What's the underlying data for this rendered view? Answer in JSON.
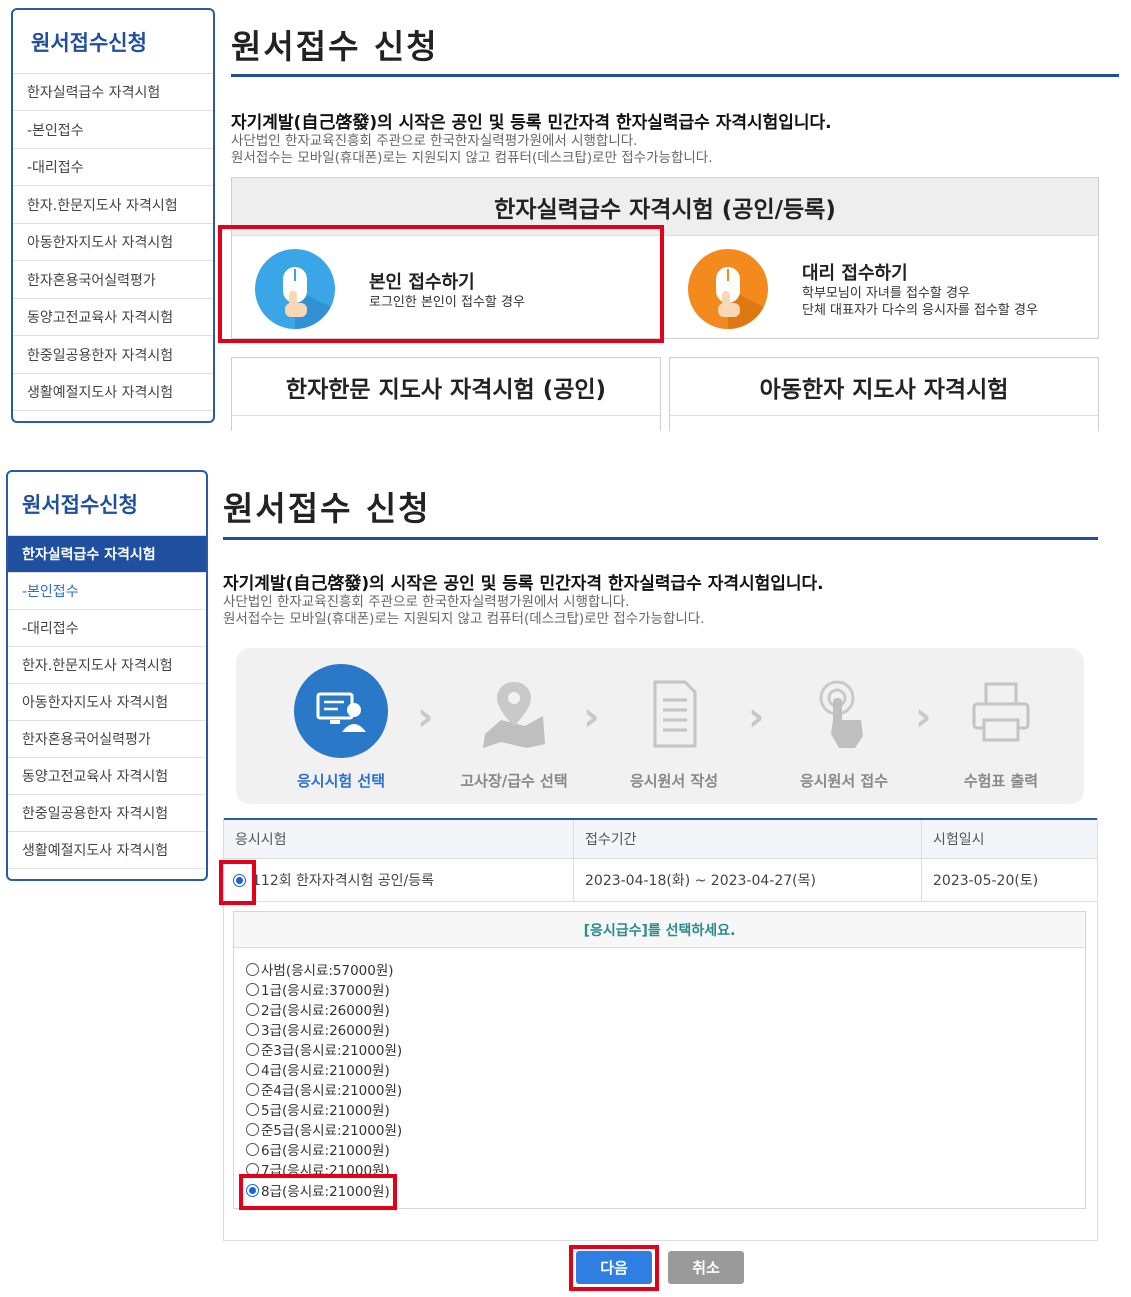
{
  "sidebar": {
    "title": "원서접수신청",
    "items": [
      "한자실력급수 자격시험",
      "-본인접수",
      "-대리접수",
      "한자.한문지도사 자격시험",
      "아동한자지도사 자격시험",
      "한자혼용국어실력평가",
      "동양고전교육사 자격시험",
      "한중일공용한자 자격시험",
      "생활예절지도사 자격시험"
    ]
  },
  "page": {
    "title": "원서접수 신청",
    "intro_prefix": "자기계발(",
    "intro_hanja": "自己啓發",
    "intro_suffix": ")의 시작은 공인 및 등록 민간자격 한자실력급수 자격시험입니다.",
    "intro_line2": "사단법인 한자교육진흥회 주관으로 한국한자실력평가원에서 시행합니다.",
    "intro_line3": "원서접수는 모바일(휴대폰)로는 지원되지 않고 컴퓨터(데스크탑)로만 접수가능합니다."
  },
  "cards": {
    "main_header": "한자실력급수 자격시험 (공인/등록)",
    "self_title": "본인 접수하기",
    "self_desc": "로그인한 본인이 접수할 경우",
    "proxy_title": "대리 접수하기",
    "proxy_desc1": "학부모님이 자녀를 접수할 경우",
    "proxy_desc2": "단체 대표자가 다수의 응시자를 접수할 경우",
    "teacher_header": "한자한문 지도사 자격시험 (공인)",
    "child_header": "아동한자 지도사 자격시험",
    "self_color": "#3aa6e8",
    "proxy_color": "#f28a1e"
  },
  "steps": [
    {
      "label": "응시시험 선택",
      "icon": "exam-select-icon"
    },
    {
      "label": "고사장/급수 선택",
      "icon": "map-pin-icon"
    },
    {
      "label": "응시원서 작성",
      "icon": "document-icon"
    },
    {
      "label": "응시원서 접수",
      "icon": "touch-icon"
    },
    {
      "label": "수험표 출력",
      "icon": "printer-icon"
    }
  ],
  "table": {
    "headers": [
      "응시시험",
      "접수기간",
      "시험일시"
    ],
    "row": {
      "exam": "112회  한자자격시험 공인/등록",
      "period": "2023-04-18(화) ~ 2023-04-27(목)",
      "date": "2023-05-20(토)"
    }
  },
  "grades": {
    "prompt": "[응시급수]를 선택하세요.",
    "options": [
      "사범(응시료:57000원)",
      "1급(응시료:37000원)",
      "2급(응시료:26000원)",
      "3급(응시료:26000원)",
      "준3급(응시료:21000원)",
      "4급(응시료:21000원)",
      "준4급(응시료:21000원)",
      "5급(응시료:21000원)",
      "준5급(응시료:21000원)",
      "6급(응시료:21000원)",
      "7급(응시료:21000원)",
      "8급(응시료:21000원)"
    ],
    "selected": "8급(응시료:21000원)"
  },
  "buttons": {
    "next": "다음",
    "cancel": "취소",
    "next_color": "#2f7fe3",
    "cancel_color": "#9a9a9a"
  }
}
